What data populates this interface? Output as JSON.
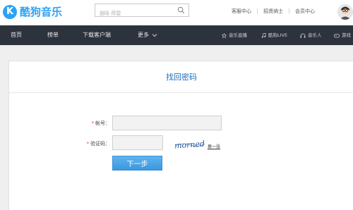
{
  "brand": {
    "mark": "K",
    "name": "酷狗音乐"
  },
  "search": {
    "placeholder": "趙晗 荷雲"
  },
  "top_links": [
    "客服中心",
    "招贤纳士",
    "会员中心"
  ],
  "nav": {
    "main": [
      "首页",
      "榜单",
      "下载客户端",
      "更多"
    ],
    "right": [
      "音乐直播",
      "酷狗LIVE",
      "音乐人",
      "游戏"
    ]
  },
  "form": {
    "title": "找回密码",
    "required_mark": "*",
    "account_label": "帐号：",
    "captcha_label": "验证码：",
    "captcha_text": "morned",
    "refresh_link": "换一张",
    "next_button": "下一步",
    "account_value": "",
    "captcha_value": ""
  },
  "colors": {
    "brand": "#2ca2f5",
    "nav_bg": "#2c333d",
    "title": "#1e6fbf",
    "button": "#3b97de"
  }
}
